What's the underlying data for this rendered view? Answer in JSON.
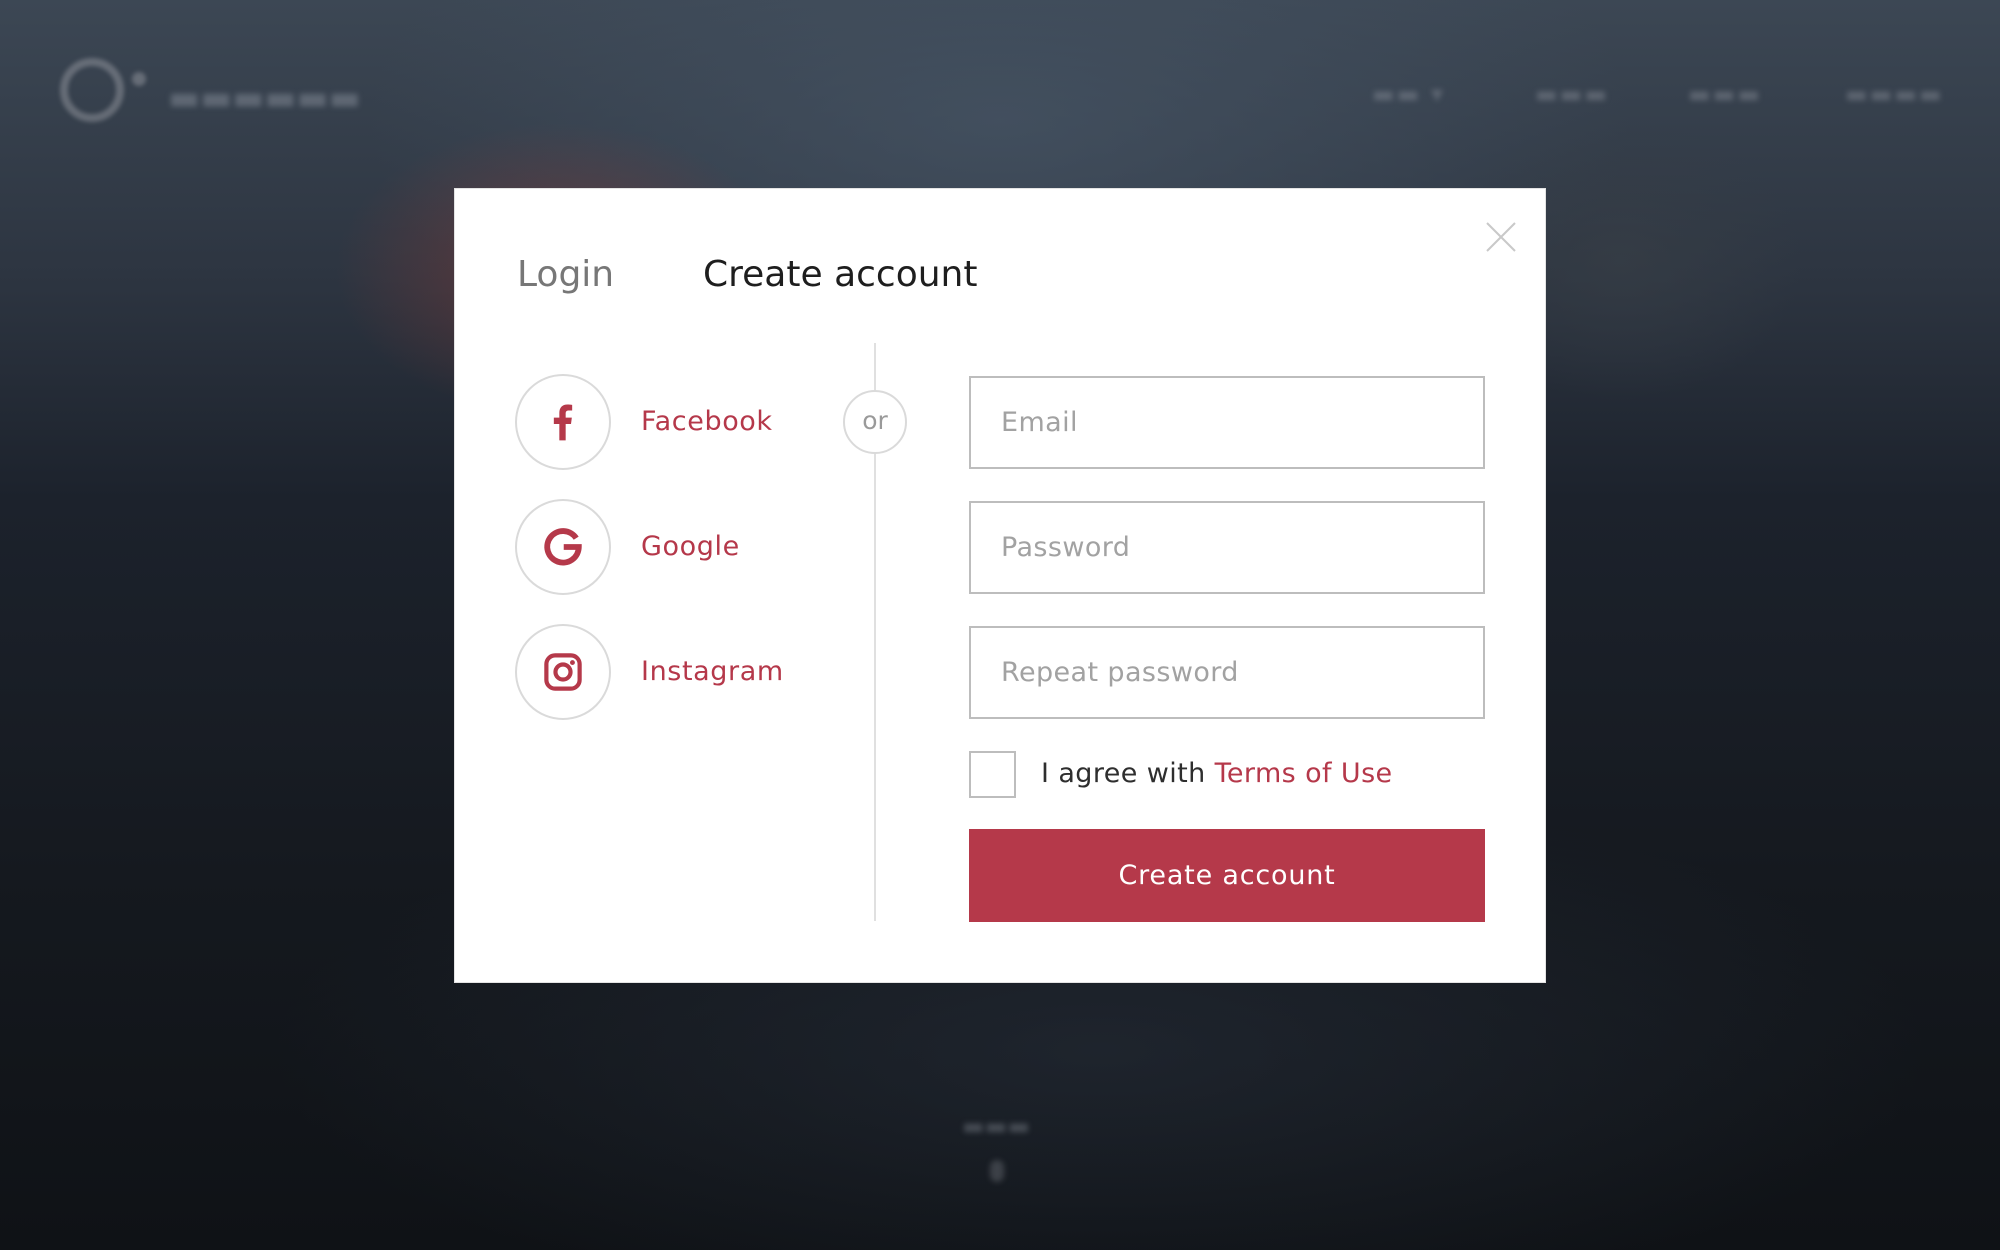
{
  "modal": {
    "tabs": {
      "login": "Login",
      "create_account": "Create account"
    },
    "social": [
      {
        "label": "Facebook",
        "icon": "facebook-icon"
      },
      {
        "label": "Google",
        "icon": "google-icon"
      },
      {
        "label": "Instagram",
        "icon": "instagram-icon"
      }
    ],
    "separator": "or",
    "form": {
      "email_placeholder": "Email",
      "password_placeholder": "Password",
      "repeat_password_placeholder": "Repeat password",
      "agree_text": "I agree with",
      "terms_link": "Terms of Use",
      "submit_label": "Create account"
    }
  },
  "colors": {
    "accent": "#b5394a",
    "modal_bg": "#ffffff",
    "border": "#bdbdbd"
  }
}
